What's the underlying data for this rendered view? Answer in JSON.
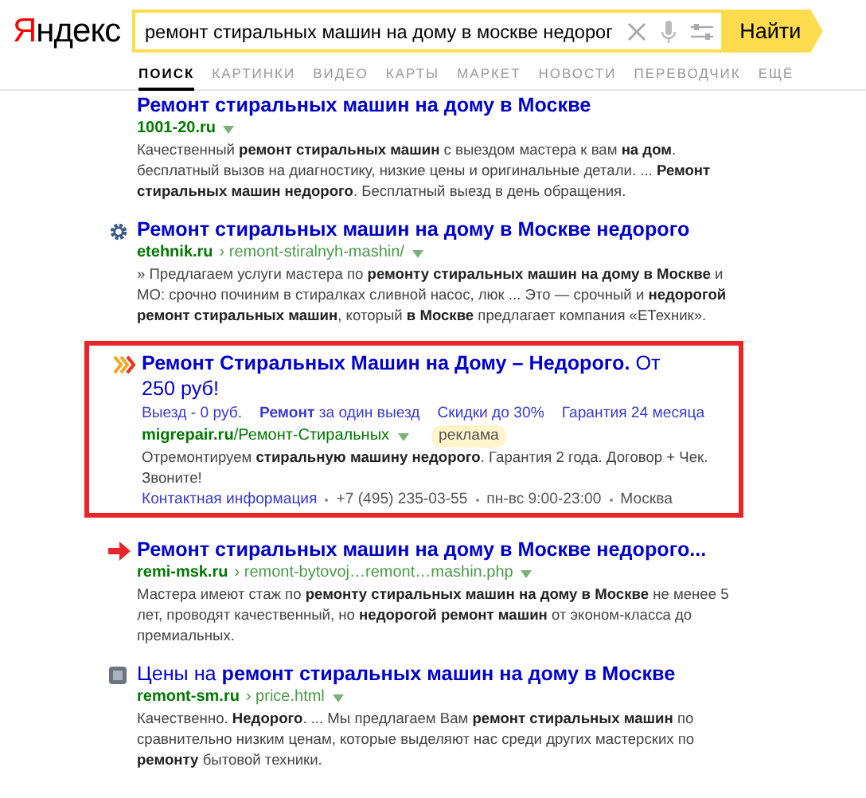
{
  "logo": "Яндекс",
  "search": {
    "value": "ремонт стиральных машин на дому в москве недорог",
    "button": "Найти"
  },
  "tabs": [
    {
      "label": "ПОИСК",
      "selected": true
    },
    {
      "label": "КАРТИНКИ",
      "selected": false
    },
    {
      "label": "ВИДЕО",
      "selected": false
    },
    {
      "label": "КАРТЫ",
      "selected": false
    },
    {
      "label": "МАРКЕТ",
      "selected": false
    },
    {
      "label": "НОВОСТИ",
      "selected": false
    },
    {
      "label": "ПЕРЕВОДЧИК",
      "selected": false
    },
    {
      "label": "ЕЩЁ",
      "selected": false
    }
  ],
  "results": [
    {
      "kind": "organic",
      "title": "Ремонт стиральных машин на дому в Москве",
      "domain": "1001-20.ru",
      "snippet": "Качественный **ремонт стиральных машин** с выездом мастера к вам **на дом**. бесплатный вызов на диагностику, низкие цены и оригинальные детали. ... **Ремонт стиральных машин недорого**. Бесплатный выезд в день обращения."
    },
    {
      "kind": "organic",
      "title": "Ремонт стиральных машин на дому в Москве недорого",
      "domain": "etehnik.ru",
      "path": "› remont-stiralnyh-mashin/",
      "snippet": "» Предлагаем услуги мастера по **ремонту стиральных машин на дому в Москве** и МО: срочно починим в стиралках сливной насос, люк ... Это — срочный и **недорогой ремонт стиральных машин**, который **в Москве** предлагает компания «ЕТехник»."
    },
    {
      "kind": "ad",
      "title": "**Ремонт Стиральных Машин на Дому – Недорого.** От 250 руб!",
      "sitelinks": [
        "Выезд - 0 руб.",
        "**Ремонт** за один выезд",
        "Скидки до 30%",
        "Гарантия 24 месяца"
      ],
      "url": "**migrepair.ru**/Ремонт-Стиральных",
      "badge": "реклама",
      "snippet": "Отремонтируем **стиральную машину недорого**. Гарантия 2 года. Договор + Чек. Звоните!",
      "contacts": [
        "Контактная информация",
        "+7 (495) 235-03-55",
        "пн-вс 9:00-23:00",
        "Москва"
      ]
    },
    {
      "kind": "organic",
      "title": "Ремонт стиральных машин на дому в Москве недорого...",
      "domain": "remi-msk.ru",
      "path": "› remont-bytovoj…remont…mashin.php",
      "snippet": "Мастера имеют стаж по **ремонту стиральных машин на дому в Москве** не менее 5 лет, проводят качественный, но **недорогой ремонт машин** от эконом-класса до премиальных."
    },
    {
      "kind": "organic",
      "title": "Цены на **ремонт стиральных машин на дому в Москве**",
      "domain": "remont-sm.ru",
      "path": "› price.html",
      "snippet": "Качественно. **Недорого**. ... Мы предлагаем Вам **ремонт стиральных машин** по сравнительно низким ценам, которые выделяют нас среди других мастерских по **ремонту** бытовой техники."
    }
  ]
}
